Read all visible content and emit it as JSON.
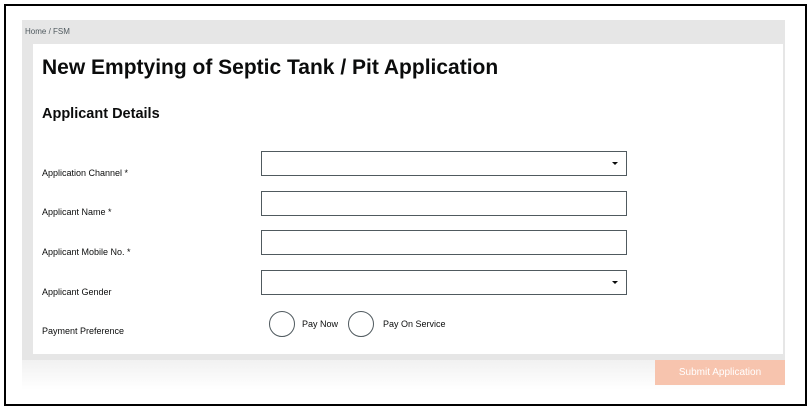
{
  "breadcrumb": "Home / FSM",
  "page_title": "New Emptying of Septic Tank / Pit Application",
  "section_title": "Applicant Details",
  "fields": [
    {
      "label": "Application Channel *",
      "type": "select",
      "value": ""
    },
    {
      "label": "Applicant Name *",
      "type": "text",
      "value": ""
    },
    {
      "label": "Applicant Mobile No. *",
      "type": "text",
      "value": ""
    },
    {
      "label": "Applicant Gender",
      "type": "select",
      "value": ""
    }
  ],
  "payment": {
    "label": "Payment Preference",
    "options": [
      "Pay Now",
      "Pay On Service"
    ]
  },
  "submit_label": "Submit Application",
  "colors": {
    "submit_background": "#f7c4ae",
    "border": "#505a5f"
  }
}
